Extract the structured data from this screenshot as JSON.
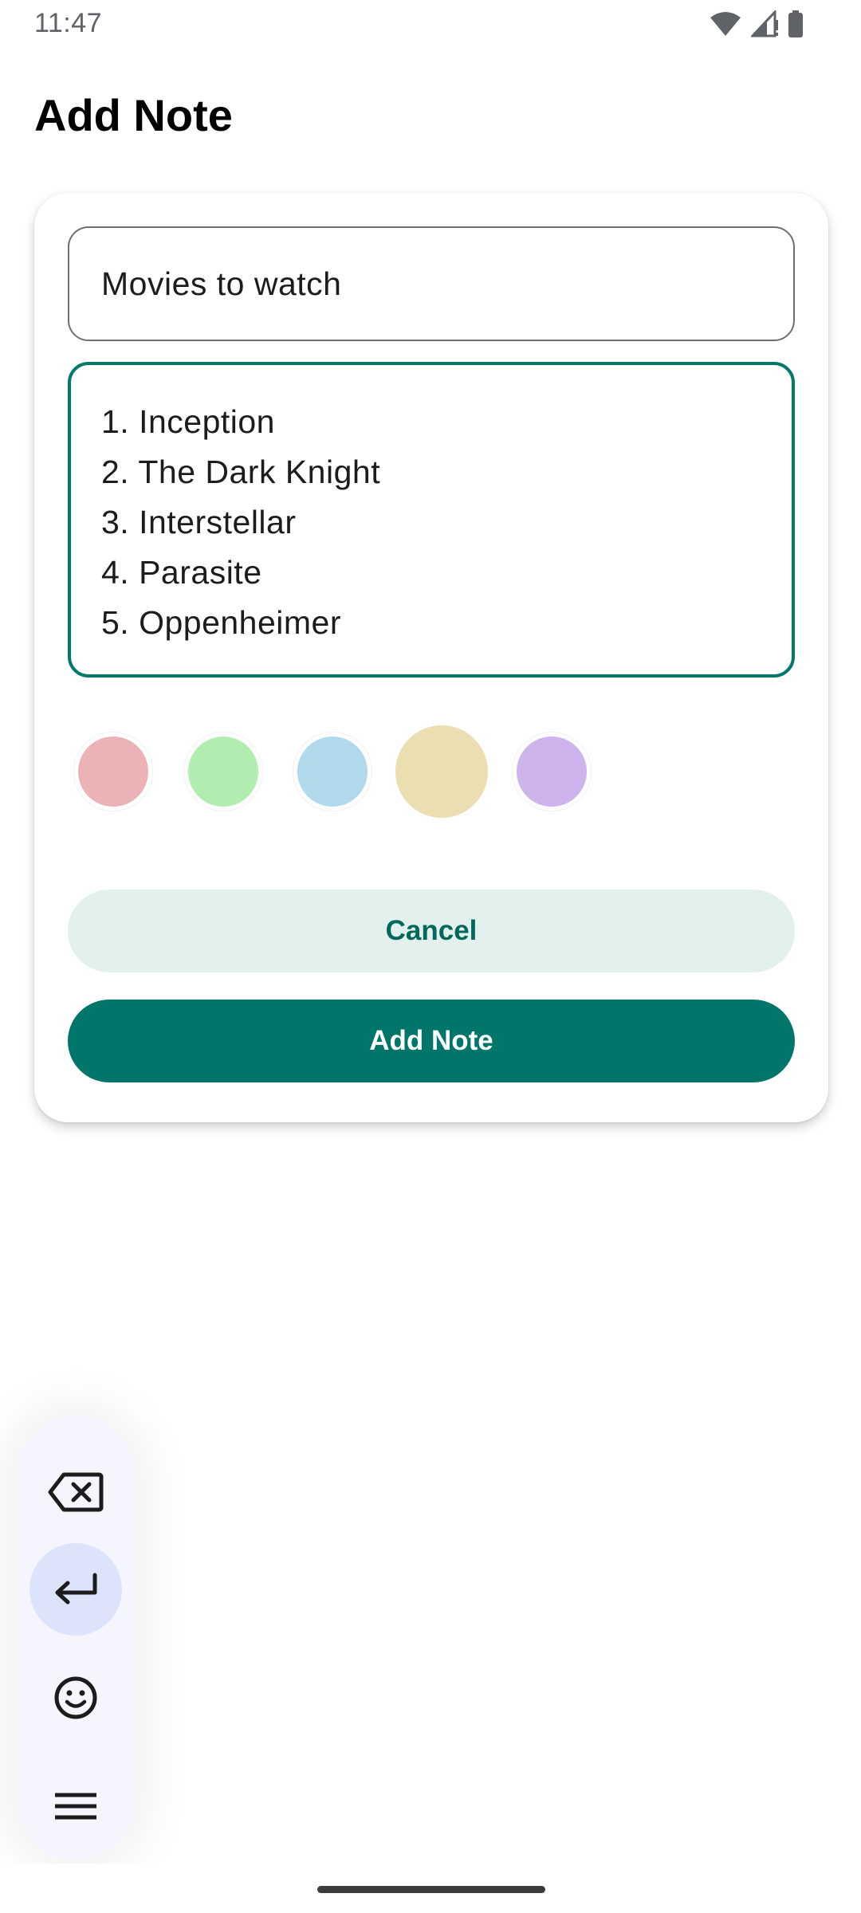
{
  "status_bar": {
    "time": "11:47",
    "icons": [
      "wifi-icon",
      "cell-signal-icon",
      "battery-icon"
    ]
  },
  "page": {
    "title": "Add Note"
  },
  "form": {
    "title_value": "Movies to watch",
    "body_lines": [
      "1. Inception",
      "2. The Dark Knight",
      "3. Interstellar",
      "4. Parasite",
      "5. Oppenheimer"
    ],
    "colors": [
      {
        "name": "red",
        "hex": "#ebb3b5",
        "selected": false
      },
      {
        "name": "green",
        "hex": "#b1ecb1",
        "selected": false
      },
      {
        "name": "blue",
        "hex": "#b0d9ec",
        "selected": false
      },
      {
        "name": "yellow",
        "hex": "#ebdeb1",
        "selected": true
      },
      {
        "name": "purple",
        "hex": "#ceb4ec",
        "selected": false
      }
    ],
    "cancel_label": "Cancel",
    "add_label": "Add Note"
  },
  "floating_toolbar": {
    "items": [
      "backspace-icon",
      "enter-icon",
      "emoji-icon",
      "menu-icon"
    ],
    "active": "enter-icon"
  },
  "theme": {
    "accent": "#00766a",
    "accent_light": "#e3f0ed",
    "toolbar_bg": "#f5f6fd",
    "toolbar_active": "#dde3fb"
  }
}
